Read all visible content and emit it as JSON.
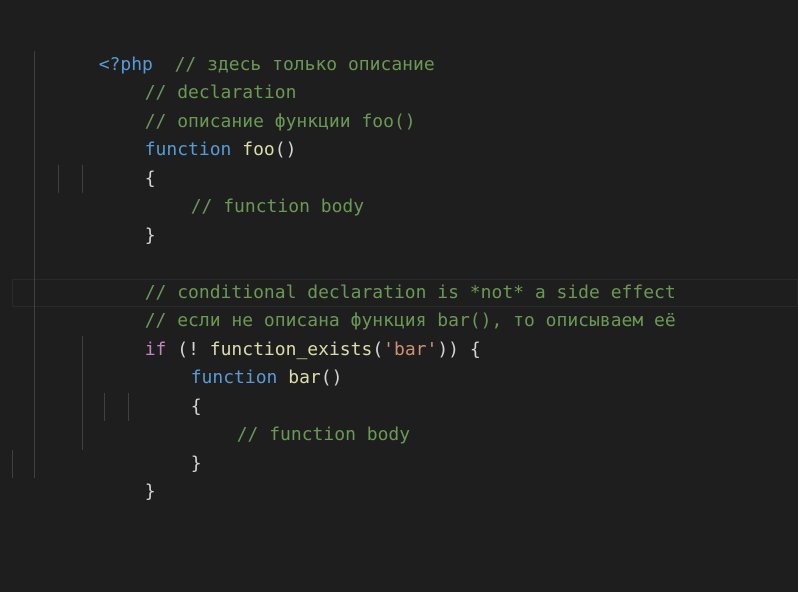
{
  "colors": {
    "background": "#1e1e1e",
    "tag": "#569cd6",
    "comment": "#6a9955",
    "keyword": "#569cd6",
    "control": "#c586c0",
    "function": "#dcdcaa",
    "string": "#ce9178",
    "text": "#d4d4d4"
  },
  "code": {
    "l1": {
      "tag": "<?php",
      "comment": "// здесь только описание"
    },
    "l2": {
      "comment": "// declaration"
    },
    "l3": {
      "comment": "// описание функции foo()"
    },
    "l4": {
      "kw": "function",
      "name": "foo",
      "rest": "()"
    },
    "l5": {
      "text": "{"
    },
    "l6": {
      "comment": "// function body"
    },
    "l7": {
      "text": "}"
    },
    "l9": {
      "comment": "// conditional declaration is *not* a side effect"
    },
    "l10": {
      "comment": "// если не описана функция bar(), то описываем её"
    },
    "l11": {
      "kw": "if",
      "p1": " (! ",
      "fn": "function_exists",
      "p2": "(",
      "str": "'bar'",
      "p3": ")) {"
    },
    "l12": {
      "kw": "function",
      "name": "bar",
      "rest": "()"
    },
    "l13": {
      "text": "{"
    },
    "l14": {
      "comment": "// function body"
    },
    "l15": {
      "text": "}"
    },
    "l16": {
      "text": "}"
    }
  }
}
